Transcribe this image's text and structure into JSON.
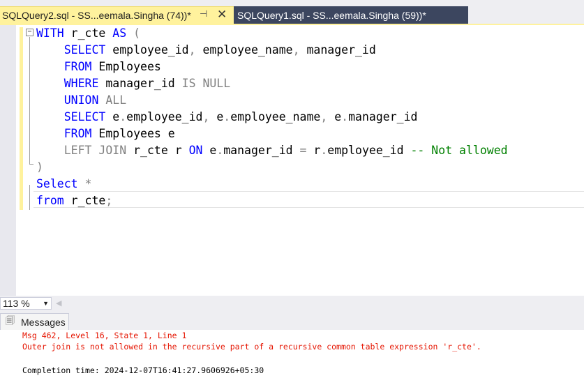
{
  "tabs": [
    {
      "label": "SQLQuery2.sql - SS...eemala.Singha (74))*",
      "active": true
    },
    {
      "label": "SQLQuery1.sql - SS...eemala.Singha (59))*",
      "active": false
    }
  ],
  "colors": {
    "accent_tab": "#fff29d",
    "inactive_tab": "#3c465f",
    "keyword": "#0000ff",
    "comment": "#008000",
    "error": "#e51400"
  },
  "editor": {
    "lines": [
      [
        {
          "t": "WITH",
          "c": "kw"
        },
        {
          "t": " r_cte ",
          "c": ""
        },
        {
          "t": "AS",
          "c": "kw"
        },
        {
          "t": " (",
          "c": "gr"
        }
      ],
      [
        {
          "t": "    ",
          "c": ""
        },
        {
          "t": "SELECT",
          "c": "kw"
        },
        {
          "t": " employee_id",
          "c": ""
        },
        {
          "t": ",",
          "c": "gr"
        },
        {
          "t": " employee_name",
          "c": ""
        },
        {
          "t": ",",
          "c": "gr"
        },
        {
          "t": " manager_id",
          "c": ""
        }
      ],
      [
        {
          "t": "    ",
          "c": ""
        },
        {
          "t": "FROM",
          "c": "kw"
        },
        {
          "t": " Employees",
          "c": ""
        }
      ],
      [
        {
          "t": "    ",
          "c": ""
        },
        {
          "t": "WHERE",
          "c": "kw"
        },
        {
          "t": " manager_id ",
          "c": ""
        },
        {
          "t": "IS NULL",
          "c": "gr"
        }
      ],
      [
        {
          "t": "    ",
          "c": ""
        },
        {
          "t": "UNION",
          "c": "kw"
        },
        {
          "t": " ",
          "c": ""
        },
        {
          "t": "ALL",
          "c": "gr"
        }
      ],
      [
        {
          "t": "    ",
          "c": ""
        },
        {
          "t": "SELECT",
          "c": "kw"
        },
        {
          "t": " e",
          "c": ""
        },
        {
          "t": ".",
          "c": "gr"
        },
        {
          "t": "employee_id",
          "c": ""
        },
        {
          "t": ",",
          "c": "gr"
        },
        {
          "t": " e",
          "c": ""
        },
        {
          "t": ".",
          "c": "gr"
        },
        {
          "t": "employee_name",
          "c": ""
        },
        {
          "t": ",",
          "c": "gr"
        },
        {
          "t": " e",
          "c": ""
        },
        {
          "t": ".",
          "c": "gr"
        },
        {
          "t": "manager_id",
          "c": ""
        }
      ],
      [
        {
          "t": "    ",
          "c": ""
        },
        {
          "t": "FROM",
          "c": "kw"
        },
        {
          "t": " Employees e",
          "c": ""
        }
      ],
      [
        {
          "t": "    ",
          "c": ""
        },
        {
          "t": "LEFT JOIN",
          "c": "gr"
        },
        {
          "t": " r_cte r ",
          "c": ""
        },
        {
          "t": "ON",
          "c": "kw"
        },
        {
          "t": " e",
          "c": ""
        },
        {
          "t": ".",
          "c": "gr"
        },
        {
          "t": "manager_id ",
          "c": ""
        },
        {
          "t": "=",
          "c": "gr"
        },
        {
          "t": " r",
          "c": ""
        },
        {
          "t": ".",
          "c": "gr"
        },
        {
          "t": "employee_id ",
          "c": ""
        },
        {
          "t": "-- Not allowed",
          "c": "cm"
        }
      ],
      [
        {
          "t": ")",
          "c": "gr"
        }
      ],
      [
        {
          "t": "Select",
          "c": "kw"
        },
        {
          "t": " ",
          "c": ""
        },
        {
          "t": "*",
          "c": "gr"
        }
      ],
      [
        {
          "t": "from",
          "c": "kw"
        },
        {
          "t": " r_cte",
          "c": ""
        },
        {
          "t": ";",
          "c": "gr"
        }
      ]
    ]
  },
  "zoom": {
    "value": "113 %"
  },
  "results": {
    "tab_label": "Messages",
    "messages": [
      {
        "text": "Msg 462, Level 16, State 1, Line 1",
        "kind": "err"
      },
      {
        "text": "Outer join is not allowed in the recursive part of a recursive common table expression 'r_cte'.",
        "kind": "err"
      },
      {
        "text": "Completion time: 2024-12-07T16:41:27.9606926+05:30",
        "kind": "ok"
      }
    ]
  }
}
